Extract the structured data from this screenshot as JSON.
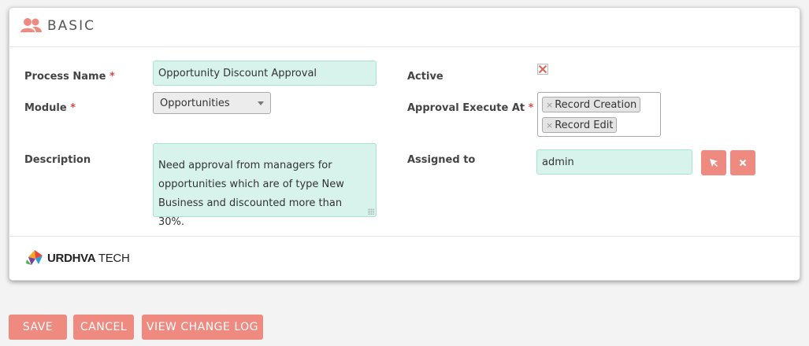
{
  "panel": {
    "title": "BASIC",
    "icon": "users-icon"
  },
  "fields": {
    "process_name": {
      "label": "Process Name",
      "required_mark": "*",
      "value": "Opportunity Discount Approval"
    },
    "module": {
      "label": "Module",
      "required_mark": "*",
      "value": "Opportunities"
    },
    "description": {
      "label": "Description",
      "value": "Need approval from managers for opportunities which are of type New Business and discounted more than 30%."
    },
    "active": {
      "label": "Active",
      "checked": false,
      "mark": "x-mark-icon"
    },
    "approval_execute_at": {
      "label": "Approval Execute At",
      "required_mark": "*",
      "remove_symbol": "×",
      "tags": [
        "Record Creation",
        "Record Edit"
      ]
    },
    "assigned_to": {
      "label": "Assigned to",
      "value": "admin",
      "select_icon": "cursor-arrow-icon",
      "clear_icon": "close-icon"
    }
  },
  "footer": {
    "brand_bold": "URDHVA",
    "brand_light": " TECH"
  },
  "actions": {
    "save": "SAVE",
    "cancel": "CANCEL",
    "view_change_log": "VIEW CHANGE LOG"
  },
  "colors": {
    "accent": "#ee8a80",
    "input_bg": "#d7f3ec",
    "required": "#d14b4b"
  }
}
